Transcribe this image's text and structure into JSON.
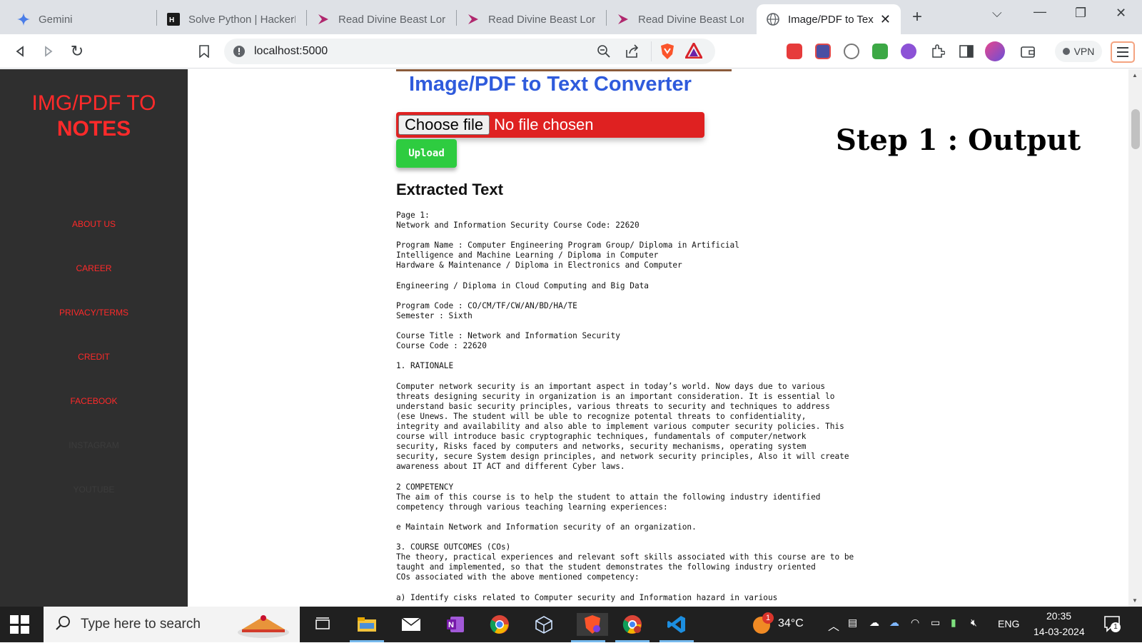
{
  "browser": {
    "tabs": [
      {
        "title": "Gemini",
        "active": false
      },
      {
        "title": "Solve Python | HackerR",
        "active": false
      },
      {
        "title": "Read Divine Beast Lord",
        "active": false
      },
      {
        "title": "Read Divine Beast Lord",
        "active": false
      },
      {
        "title": "Read Divine Beast Lord",
        "active": false
      },
      {
        "title": "Image/PDF to Tex",
        "active": true
      }
    ],
    "new_tab": "+",
    "url": "localhost:5000",
    "vpn_label": "VPN"
  },
  "sidebar": {
    "brand_line1": "IMG/PDF TO",
    "brand_line2": "NOTES",
    "nav": [
      "ABOUT US",
      "CAREER",
      "PRIVACY/TERMS",
      "CREDIT",
      "FACEBOOK",
      "INSTAGRAM",
      "YOUTUBE"
    ]
  },
  "main": {
    "title": "Image/PDF to Text Converter",
    "choose_file": "Choose file",
    "file_status": "No file chosen",
    "upload": "Upload",
    "extracted_heading": "Extracted Text",
    "extracted_lines": [
      "Page 1:",
      "Network and Information Security Course Code: 22620",
      "",
      "Program Name : Computer Engineering Program Group/ Diploma in Artificial",
      "Intelligence and Machine Learning / Diploma in Computer",
      "Hardware & Maintenance / Diploma in Electronics and Computer",
      "",
      "Engineering / Diploma in Cloud Computing and Big Data",
      "",
      "Program Code : CO/CM/TF/CW/AN/BD/HA/TE",
      "Semester : Sixth",
      "",
      "Course Title : Network and Information Security",
      "Course Code : 22620",
      "",
      "1. RATIONALE",
      "",
      "Computer network security is an important aspect in today’s world. Now days due to various",
      "threats designing security in organization is an important consideration. It is essential lo",
      "understand basic security principles, various threats to security and techniques to address",
      "(ese Unews. The student will be uble to recognize potental threats to confidentiality,",
      "integrity and availability and also able to implement various computer security policies. This",
      "course will introduce basic cryptographic techniques, fundamentals of computer/network",
      "security, Risks faced by computers and networks, security mechanisms, operating system",
      "security, secure System design principles, and network security principles, Also it will create",
      "awareness about IT ACT and different Cyber laws.",
      "",
      "2 COMPETENCY",
      "The aim of this course is to help the student to attain the following industry identified",
      "competency through various teaching learning experiences:",
      "",
      "e Maintain Network and Information security of an organization.",
      "",
      "3. COURSE OUTCOMES (COs)",
      "The theory, practical experiences and relevant soft skills associated with this course are to be",
      "taught and implemented, so that the student demonstrates the following industry oriented",
      "COs associated with the above mentioned competency:",
      "",
      "a) Identify cisks related to Computer security and Information hazard in various"
    ],
    "step_label": "Step 1 : Output"
  },
  "taskbar": {
    "search_placeholder": "Type here to search",
    "temperature": "34°C",
    "weather_badge": "1",
    "language": "ENG",
    "time": "20:35",
    "date": "14-03-2024",
    "notification_count": "1"
  }
}
